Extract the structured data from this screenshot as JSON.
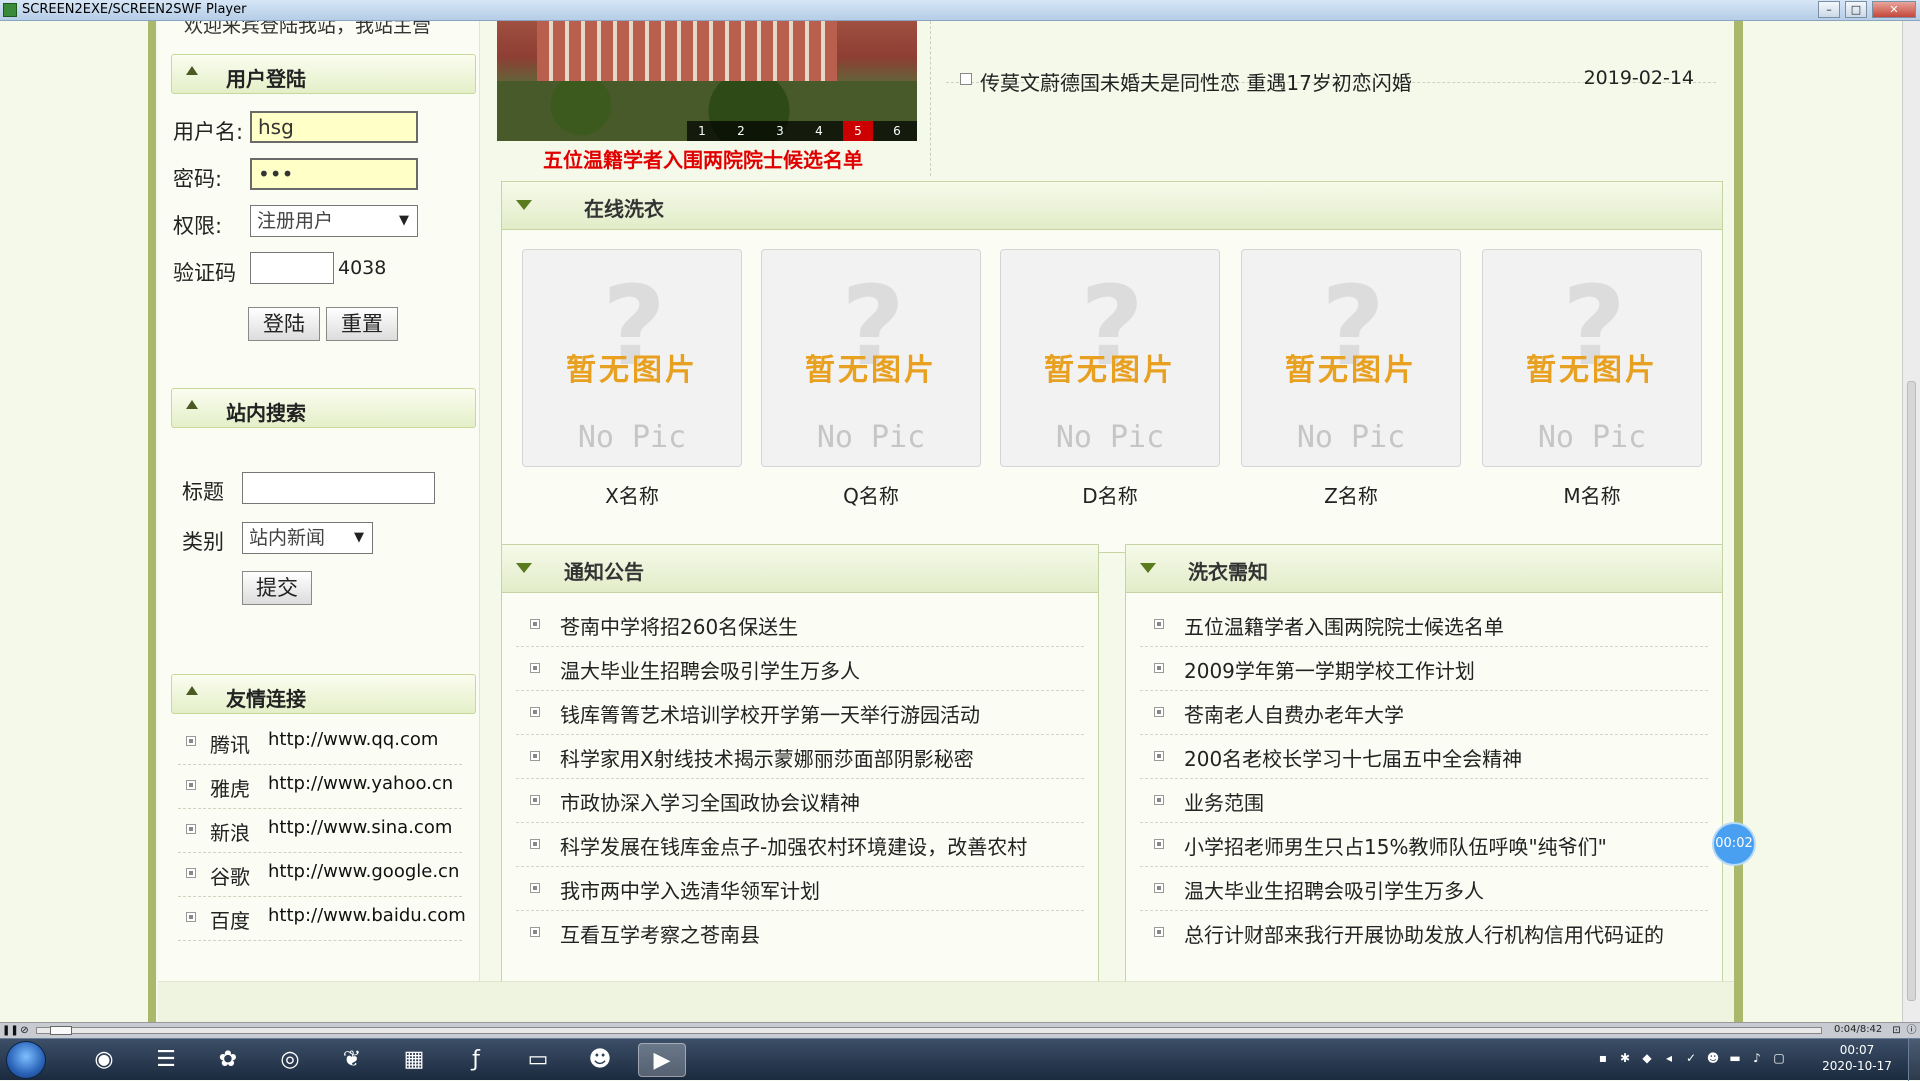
{
  "window": {
    "title": "SCREEN2EXE/SCREEN2SWF Player"
  },
  "sidebar": {
    "welcome": "欢迎来宾登陆我站，我站主营",
    "login": {
      "title": "用户登陆",
      "username_label": "用户名:",
      "username_value": "hsg",
      "password_label": "密码:",
      "password_value": "•••",
      "role_label": "权限:",
      "role_value": "注册用户",
      "captcha_label": "验证码",
      "captcha_value": "",
      "captcha_code": "4038",
      "login_button": "登陆",
      "reset_button": "重置"
    },
    "search": {
      "title": "站内搜索",
      "title_label": "标题",
      "title_value": "",
      "category_label": "类别",
      "category_value": "站内新闻",
      "submit_button": "提交"
    },
    "links": {
      "title": "友情连接",
      "items": [
        {
          "name": "腾讯",
          "url": "http://www.qq.com"
        },
        {
          "name": "雅虎",
          "url": "http://www.yahoo.cn"
        },
        {
          "name": "新浪",
          "url": "http://www.sina.com"
        },
        {
          "name": "谷歌",
          "url": "http://www.google.cn"
        },
        {
          "name": "百度",
          "url": "http://www.baidu.com"
        }
      ]
    }
  },
  "banner": {
    "caption": "五位温籍学者入围两院院士候选名单",
    "pages": [
      "1",
      "2",
      "3",
      "4",
      "5",
      "6"
    ],
    "active_page": "5"
  },
  "top_news": {
    "title": "传莫文蔚德国未婚夫是同性恋 重遇17岁初恋闪婚",
    "date": "2019-02-14"
  },
  "laundry": {
    "title": "在线洗衣",
    "placeholder_cn": "暂无图片",
    "placeholder_en": "No Pic",
    "items": [
      {
        "name": "X名称"
      },
      {
        "name": "Q名称"
      },
      {
        "name": "D名称"
      },
      {
        "name": "Z名称"
      },
      {
        "name": "M名称"
      }
    ]
  },
  "notices": {
    "title": "通知公告",
    "items": [
      "苍南中学将招260名保送生",
      "温大毕业生招聘会吸引学生万多人",
      "钱库箐箐艺术培训学校开学第一天举行游园活动",
      "科学家用X射线技术揭示蒙娜丽莎面部阴影秘密",
      "市政协深入学习全国政协会议精神",
      "科学发展在钱库金点子-加强农村环境建设，改善农村",
      "我市两中学入选清华领军计划",
      "互看互学考察之苍南县"
    ]
  },
  "laundry_notes": {
    "title": "洗衣需知",
    "items": [
      "五位温籍学者入围两院院士候选名单",
      "2009学年第一学期学校工作计划",
      "苍南老人自费办老年大学",
      "200名老校长学习十七届五中全会精神",
      "业务范围",
      "小学招老师男生只占15%教师队伍呼唤\"纯爷们\"",
      "温大毕业生招聘会吸引学生万多人",
      "总行计财部来我行开展协助发放人行机构信用代码证的"
    ]
  },
  "player": {
    "time": "0:04/8:42",
    "timer": "00:02"
  },
  "taskbar": {
    "clock_time": "00:07",
    "clock_date": "2020-10-17"
  }
}
